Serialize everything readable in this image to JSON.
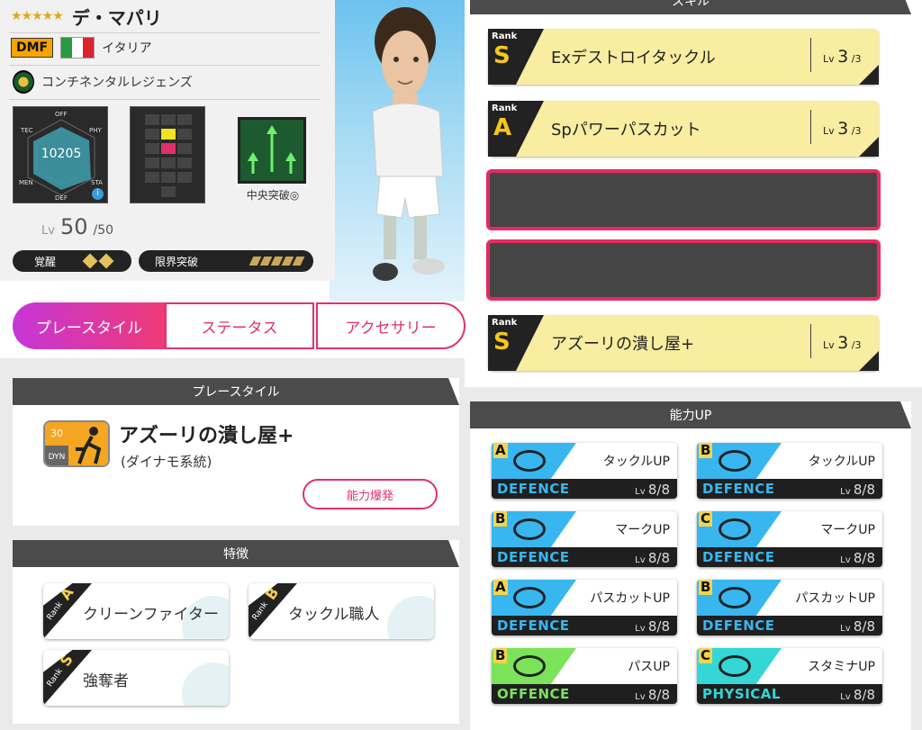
{
  "player": {
    "stars": "★★★★★",
    "name": "デ・マパリ",
    "position": "DMF",
    "country": "イタリア",
    "team": "コンチネンタルレジェンズ",
    "radar_value": "10205",
    "radar_labels": [
      "OFF",
      "PHY",
      "STA",
      "DEF",
      "MEN",
      "TEC"
    ],
    "tactic_label": "中央突破◎",
    "lv_label": "Lv",
    "level": "50",
    "level_max": "/50",
    "awaken_label": "覚醒",
    "limit_label": "限界突破",
    "flag_colors": [
      "#2a9a42",
      "#ffffff",
      "#d7262e"
    ]
  },
  "tabs": [
    {
      "label": "プレースタイル",
      "active": true
    },
    {
      "label": "ステータス",
      "active": false
    },
    {
      "label": "アクセサリー",
      "active": false
    }
  ],
  "playstyle": {
    "header": "プレースタイル",
    "icon_level": "30",
    "icon_code": "DYN",
    "name": "アズーリの潰し屋+",
    "sub": "(ダイナモ系統)",
    "burst_button": "能力爆発"
  },
  "traits": {
    "header": "特徴",
    "rank_label": "Rank",
    "items": [
      {
        "rank": "A",
        "label": "クリーンファイター"
      },
      {
        "rank": "B",
        "label": "タックル職人"
      },
      {
        "rank": "S",
        "label": "強奪者"
      }
    ]
  },
  "skills": {
    "header": "スキル",
    "rank_label": "Rank",
    "lv_label": "Lv",
    "items": [
      {
        "rank": "S",
        "name": "Exデストロイタックル",
        "lv": "3",
        "max": "/3",
        "empty": false
      },
      {
        "rank": "A",
        "name": "Spパワーパスカット",
        "lv": "3",
        "max": "/3",
        "empty": false
      },
      {
        "rank": "",
        "name": "",
        "lv": "",
        "max": "",
        "empty": true
      },
      {
        "rank": "",
        "name": "",
        "lv": "",
        "max": "",
        "empty": true
      },
      {
        "rank": "S",
        "name": "アズーリの潰し屋+",
        "lv": "3",
        "max": "/3",
        "empty": false
      }
    ]
  },
  "ability_up": {
    "header": "能力UP",
    "lv_label": "Lv",
    "items": [
      {
        "grade": "A",
        "name": "タックルUP",
        "category": "DEFENCE",
        "lv": "8/8",
        "color": "#38b6f0"
      },
      {
        "grade": "B",
        "name": "タックルUP",
        "category": "DEFENCE",
        "lv": "8/8",
        "color": "#38b6f0"
      },
      {
        "grade": "B",
        "name": "マークUP",
        "category": "DEFENCE",
        "lv": "8/8",
        "color": "#38b6f0"
      },
      {
        "grade": "C",
        "name": "マークUP",
        "category": "DEFENCE",
        "lv": "8/8",
        "color": "#38b6f0"
      },
      {
        "grade": "A",
        "name": "パスカットUP",
        "category": "DEFENCE",
        "lv": "8/8",
        "color": "#38b6f0"
      },
      {
        "grade": "B",
        "name": "パスカットUP",
        "category": "DEFENCE",
        "lv": "8/8",
        "color": "#38b6f0"
      },
      {
        "grade": "B",
        "name": "パスUP",
        "category": "OFFENCE",
        "lv": "8/8",
        "color": "#7be35a"
      },
      {
        "grade": "C",
        "name": "スタミナUP",
        "category": "PHYSICAL",
        "lv": "8/8",
        "color": "#34d6d6"
      }
    ]
  }
}
